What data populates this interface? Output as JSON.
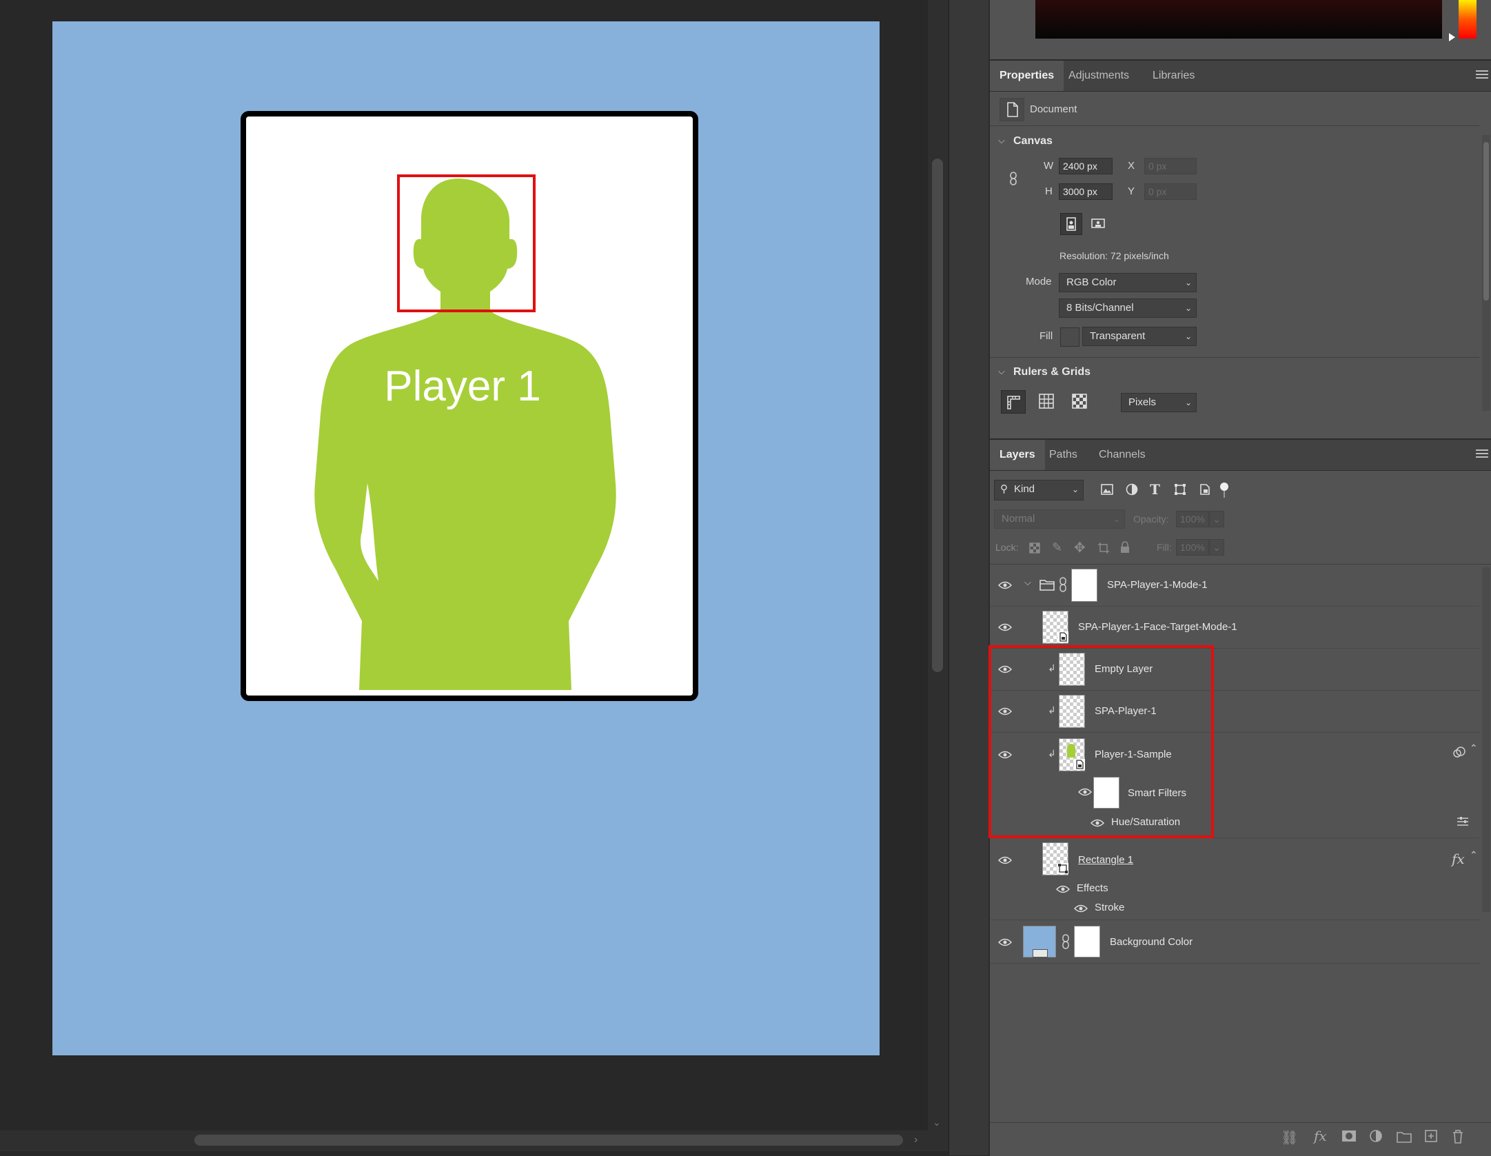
{
  "canvas": {
    "card_text": "Player 1",
    "colors": {
      "background": "#87b0da",
      "silhouette": "#a6ce38",
      "face_target": "#e01010"
    }
  },
  "properties_panel": {
    "tabs": [
      "Properties",
      "Adjustments",
      "Libraries"
    ],
    "active_tab": "Properties",
    "document_label": "Document",
    "canvas_section": {
      "title": "Canvas",
      "w_label": "W",
      "w_value": "2400 px",
      "h_label": "H",
      "h_value": "3000 px",
      "x_label": "X",
      "x_value": "0 px",
      "y_label": "Y",
      "y_value": "0 px",
      "resolution": "Resolution: 72 pixels/inch",
      "mode_label": "Mode",
      "mode_value": "RGB Color",
      "bits_value": "8 Bits/Channel",
      "fill_label": "Fill",
      "fill_value": "Transparent"
    },
    "rulers_section": {
      "title": "Rulers & Grids",
      "units_value": "Pixels"
    }
  },
  "layers_panel": {
    "tabs": [
      "Layers",
      "Paths",
      "Channels"
    ],
    "active_tab": "Layers",
    "filter_kind": "Kind",
    "blend_mode": "Normal",
    "opacity_label": "Opacity:",
    "opacity_value": "100%",
    "lock_label": "Lock:",
    "fill_label": "Fill:",
    "fill_value": "100%",
    "layers": [
      {
        "name": "SPA-Player-1-Mode-1",
        "type": "group"
      },
      {
        "name": "SPA-Player-1-Face-Target-Mode-1",
        "type": "smart-object"
      },
      {
        "name": "Empty Layer",
        "type": "clipped"
      },
      {
        "name": "SPA-Player-1",
        "type": "clipped"
      },
      {
        "name": "Player-1-Sample",
        "type": "clipped-smart-object"
      },
      {
        "name": "Smart Filters",
        "type": "smart-filters"
      },
      {
        "name": "Hue/Saturation",
        "type": "filter"
      },
      {
        "name": "Rectangle 1",
        "type": "shape"
      },
      {
        "name": "Effects",
        "type": "effects"
      },
      {
        "name": "Stroke",
        "type": "effect"
      },
      {
        "name": "Background Color",
        "type": "fill"
      }
    ],
    "fx_label": "fx"
  }
}
